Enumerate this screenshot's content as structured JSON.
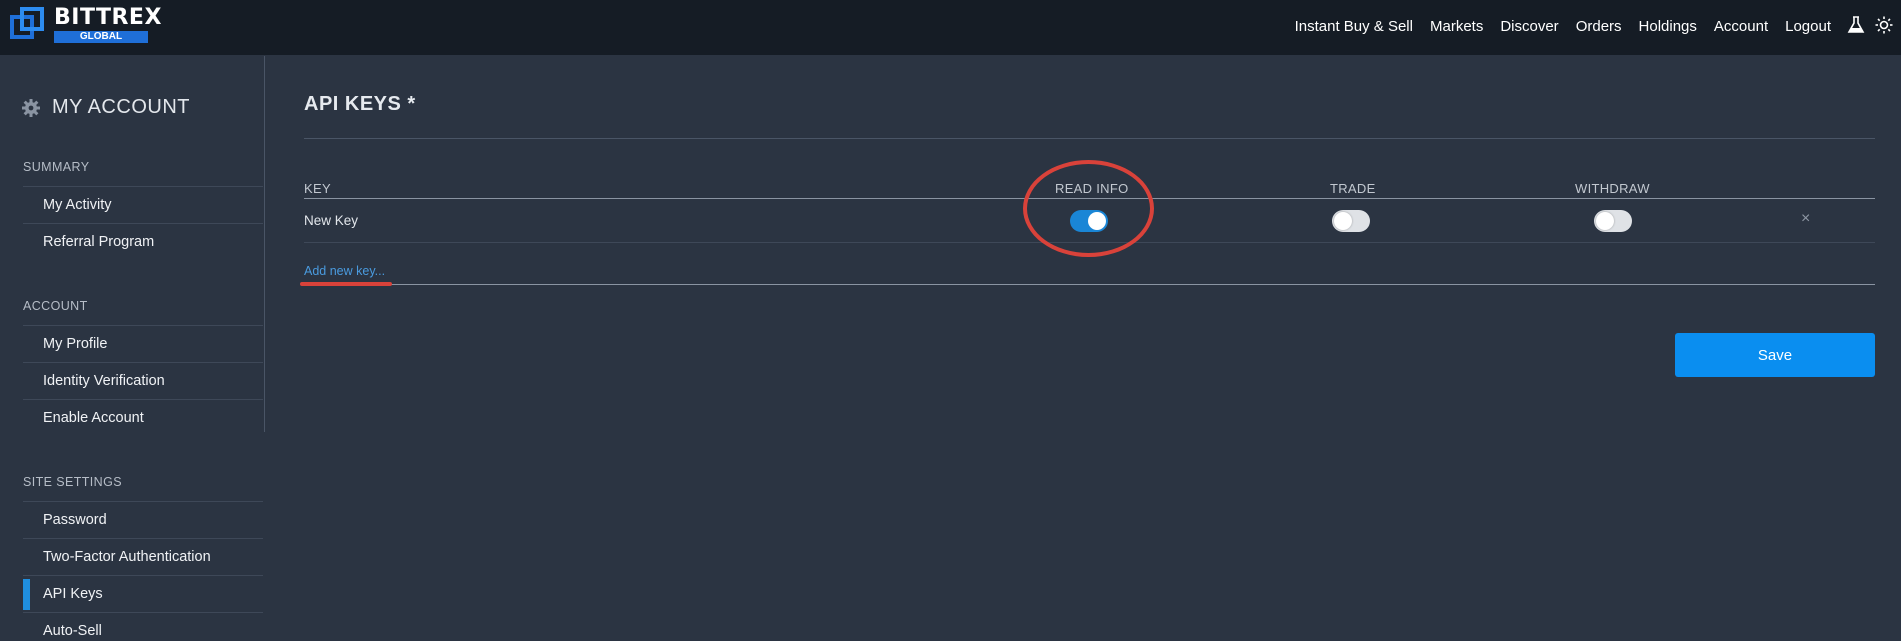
{
  "brand": {
    "name": "BITTREX",
    "sub": "GLOBAL",
    "color": "#1f6fd8"
  },
  "nav": [
    "Instant Buy & Sell",
    "Markets",
    "Discover",
    "Orders",
    "Holdings",
    "Account",
    "Logout"
  ],
  "top_icons": [
    "flask-icon",
    "sun-icon"
  ],
  "sidebar": {
    "title": "MY ACCOUNT",
    "sections": [
      {
        "heading": "SUMMARY",
        "items": [
          "My Activity",
          "Referral Program"
        ]
      },
      {
        "heading": "ACCOUNT",
        "items": [
          "My Profile",
          "Identity Verification",
          "Enable Account"
        ]
      },
      {
        "heading": "SITE SETTINGS",
        "items": [
          "Password",
          "Two-Factor Authentication",
          "API Keys",
          "Auto-Sell"
        ]
      }
    ],
    "active_item": "API Keys"
  },
  "main": {
    "title": "API KEYS *",
    "columns": {
      "key": "KEY",
      "read": "READ INFO",
      "trade": "TRADE",
      "withdraw": "WITHDRAW"
    },
    "rows": [
      {
        "name": "New Key",
        "read_info": true,
        "trade": false,
        "withdraw": false,
        "delete_label": "×"
      }
    ],
    "add_link": "Add new key...",
    "save_label": "Save"
  },
  "colors": {
    "accent": "#0a8ef0",
    "annotation": "#d9423a",
    "background": "#2b3442"
  }
}
